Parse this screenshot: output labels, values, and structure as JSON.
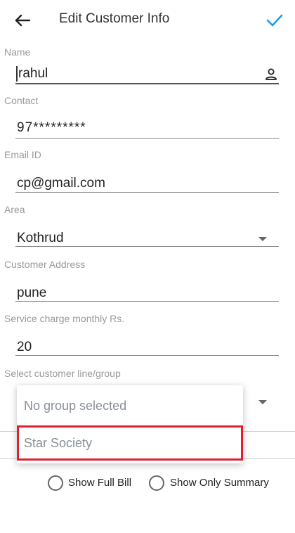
{
  "header": {
    "title": "Edit Customer Info"
  },
  "form": {
    "name_label": "Name",
    "name_value": "rahul",
    "contact_label": "Contact",
    "contact_value": "97*********",
    "email_label": "Email ID",
    "email_value": "cp@gmail.com",
    "area_label": "Area",
    "area_value": "Kothrud",
    "address_label": "Customer Address",
    "address_value": "pune",
    "service_label": "Service charge monthly Rs.",
    "service_value": "20",
    "group_label": "Select customer line/group"
  },
  "group_menu": {
    "items": [
      "No group selected",
      "Star Society"
    ]
  },
  "bill_options": {
    "full_bill_label": "Show Full Bill",
    "summary_label": "Show Only Summary"
  },
  "colors": {
    "accent": "#1e9be6",
    "highlight_border": "#e02030"
  },
  "icons": {
    "back": "arrow-left",
    "save": "checkmark",
    "name_field": "person",
    "dropdown": "triangle-down"
  }
}
